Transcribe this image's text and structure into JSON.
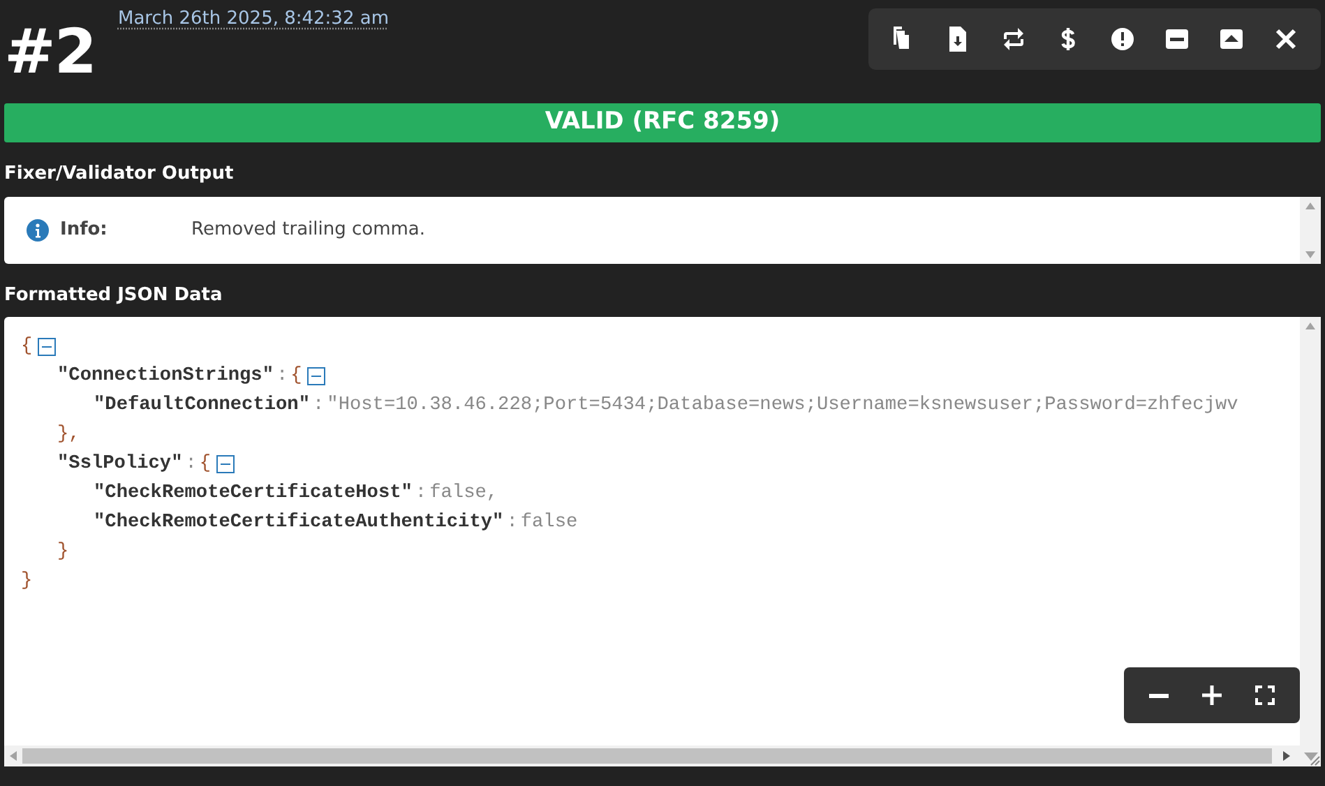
{
  "header": {
    "number": "#2",
    "timestamp": "March 26th 2025, 8:42:32 am"
  },
  "status": {
    "text": "VALID (RFC 8259)",
    "valid": true
  },
  "output": {
    "title": "Fixer/Validator Output",
    "messages": [
      {
        "label": "Info:",
        "text": "Removed trailing comma."
      }
    ]
  },
  "formatted": {
    "title": "Formatted JSON Data",
    "tree": {
      "kind": "object",
      "open": "{",
      "expanded": true,
      "close": "}",
      "children": [
        {
          "kind": "object",
          "key": "\"ConnectionStrings\"",
          "colon": ":",
          "open": "{",
          "expanded": true,
          "close": "},",
          "children": [
            {
              "kind": "value",
              "key": "\"DefaultConnection\"",
              "colon": ":",
              "value": "\"Host=10.38.46.228;Port=5434;Database=news;Username=ksnewsuser;Password=zhfecjwv"
            }
          ]
        },
        {
          "kind": "object",
          "key": "\"SslPolicy\"",
          "colon": ":",
          "open": "{",
          "expanded": true,
          "close": "}",
          "children": [
            {
              "kind": "value",
              "key": "\"CheckRemoteCertificateHost\"",
              "colon": ":",
              "value": "false,"
            },
            {
              "kind": "value",
              "key": "\"CheckRemoteCertificateAuthenticity\"",
              "colon": ":",
              "value": "false"
            }
          ]
        }
      ]
    }
  }
}
